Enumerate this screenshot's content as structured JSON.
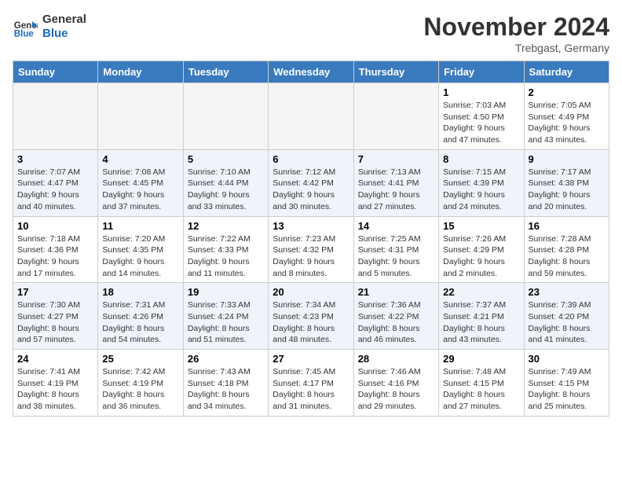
{
  "header": {
    "logo_line1": "General",
    "logo_line2": "Blue",
    "month": "November 2024",
    "location": "Trebgast, Germany"
  },
  "weekdays": [
    "Sunday",
    "Monday",
    "Tuesday",
    "Wednesday",
    "Thursday",
    "Friday",
    "Saturday"
  ],
  "weeks": [
    [
      {
        "day": "",
        "info": ""
      },
      {
        "day": "",
        "info": ""
      },
      {
        "day": "",
        "info": ""
      },
      {
        "day": "",
        "info": ""
      },
      {
        "day": "",
        "info": ""
      },
      {
        "day": "1",
        "info": "Sunrise: 7:03 AM\nSunset: 4:50 PM\nDaylight: 9 hours and 47 minutes."
      },
      {
        "day": "2",
        "info": "Sunrise: 7:05 AM\nSunset: 4:49 PM\nDaylight: 9 hours and 43 minutes."
      }
    ],
    [
      {
        "day": "3",
        "info": "Sunrise: 7:07 AM\nSunset: 4:47 PM\nDaylight: 9 hours and 40 minutes."
      },
      {
        "day": "4",
        "info": "Sunrise: 7:08 AM\nSunset: 4:45 PM\nDaylight: 9 hours and 37 minutes."
      },
      {
        "day": "5",
        "info": "Sunrise: 7:10 AM\nSunset: 4:44 PM\nDaylight: 9 hours and 33 minutes."
      },
      {
        "day": "6",
        "info": "Sunrise: 7:12 AM\nSunset: 4:42 PM\nDaylight: 9 hours and 30 minutes."
      },
      {
        "day": "7",
        "info": "Sunrise: 7:13 AM\nSunset: 4:41 PM\nDaylight: 9 hours and 27 minutes."
      },
      {
        "day": "8",
        "info": "Sunrise: 7:15 AM\nSunset: 4:39 PM\nDaylight: 9 hours and 24 minutes."
      },
      {
        "day": "9",
        "info": "Sunrise: 7:17 AM\nSunset: 4:38 PM\nDaylight: 9 hours and 20 minutes."
      }
    ],
    [
      {
        "day": "10",
        "info": "Sunrise: 7:18 AM\nSunset: 4:36 PM\nDaylight: 9 hours and 17 minutes."
      },
      {
        "day": "11",
        "info": "Sunrise: 7:20 AM\nSunset: 4:35 PM\nDaylight: 9 hours and 14 minutes."
      },
      {
        "day": "12",
        "info": "Sunrise: 7:22 AM\nSunset: 4:33 PM\nDaylight: 9 hours and 11 minutes."
      },
      {
        "day": "13",
        "info": "Sunrise: 7:23 AM\nSunset: 4:32 PM\nDaylight: 9 hours and 8 minutes."
      },
      {
        "day": "14",
        "info": "Sunrise: 7:25 AM\nSunset: 4:31 PM\nDaylight: 9 hours and 5 minutes."
      },
      {
        "day": "15",
        "info": "Sunrise: 7:26 AM\nSunset: 4:29 PM\nDaylight: 9 hours and 2 minutes."
      },
      {
        "day": "16",
        "info": "Sunrise: 7:28 AM\nSunset: 4:28 PM\nDaylight: 8 hours and 59 minutes."
      }
    ],
    [
      {
        "day": "17",
        "info": "Sunrise: 7:30 AM\nSunset: 4:27 PM\nDaylight: 8 hours and 57 minutes."
      },
      {
        "day": "18",
        "info": "Sunrise: 7:31 AM\nSunset: 4:26 PM\nDaylight: 8 hours and 54 minutes."
      },
      {
        "day": "19",
        "info": "Sunrise: 7:33 AM\nSunset: 4:24 PM\nDaylight: 8 hours and 51 minutes."
      },
      {
        "day": "20",
        "info": "Sunrise: 7:34 AM\nSunset: 4:23 PM\nDaylight: 8 hours and 48 minutes."
      },
      {
        "day": "21",
        "info": "Sunrise: 7:36 AM\nSunset: 4:22 PM\nDaylight: 8 hours and 46 minutes."
      },
      {
        "day": "22",
        "info": "Sunrise: 7:37 AM\nSunset: 4:21 PM\nDaylight: 8 hours and 43 minutes."
      },
      {
        "day": "23",
        "info": "Sunrise: 7:39 AM\nSunset: 4:20 PM\nDaylight: 8 hours and 41 minutes."
      }
    ],
    [
      {
        "day": "24",
        "info": "Sunrise: 7:41 AM\nSunset: 4:19 PM\nDaylight: 8 hours and 38 minutes."
      },
      {
        "day": "25",
        "info": "Sunrise: 7:42 AM\nSunset: 4:19 PM\nDaylight: 8 hours and 36 minutes."
      },
      {
        "day": "26",
        "info": "Sunrise: 7:43 AM\nSunset: 4:18 PM\nDaylight: 8 hours and 34 minutes."
      },
      {
        "day": "27",
        "info": "Sunrise: 7:45 AM\nSunset: 4:17 PM\nDaylight: 8 hours and 31 minutes."
      },
      {
        "day": "28",
        "info": "Sunrise: 7:46 AM\nSunset: 4:16 PM\nDaylight: 8 hours and 29 minutes."
      },
      {
        "day": "29",
        "info": "Sunrise: 7:48 AM\nSunset: 4:15 PM\nDaylight: 8 hours and 27 minutes."
      },
      {
        "day": "30",
        "info": "Sunrise: 7:49 AM\nSunset: 4:15 PM\nDaylight: 8 hours and 25 minutes."
      }
    ]
  ]
}
